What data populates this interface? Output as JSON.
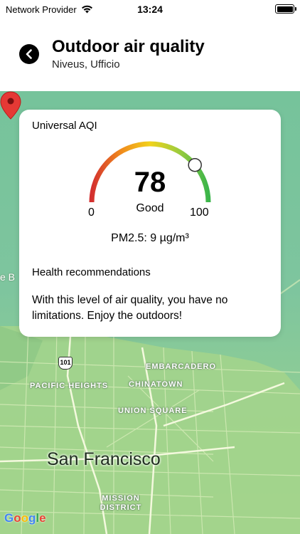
{
  "status_bar": {
    "carrier": "Network Provider",
    "time": "13:24"
  },
  "header": {
    "title": "Outdoor air quality",
    "subtitle": "Niveus, Ufficio"
  },
  "aqi_card": {
    "title": "Universal AQI",
    "value": "78",
    "category": "Good",
    "scale_min": "0",
    "scale_max": "100",
    "gauge_level": 0.78,
    "pollutant": "PM2.5: 9 µg/m³",
    "health_title": "Health recommendations",
    "health_text": "With this level of air quality, you have no limitations. Enjoy the outdoors!"
  },
  "map": {
    "labels": {
      "embarcadero": "EMBARCADERO",
      "chinatown": "CHINATOWN",
      "pacific_heights": "PACIFIC HEIGHTS",
      "union_square": "UNION SQUARE",
      "mission_district": "MISSION DISTRICT",
      "city": "San Francisco",
      "highway": "101",
      "edge": "e B"
    },
    "attribution": [
      "G",
      "o",
      "o",
      "g",
      "l",
      "e"
    ],
    "colors": {
      "overlay": "#7ec59e",
      "pin": "#e53935",
      "gauge_red": "#d32f2f",
      "gauge_yellow": "#f2d21b",
      "gauge_green": "#3bb54a"
    }
  }
}
